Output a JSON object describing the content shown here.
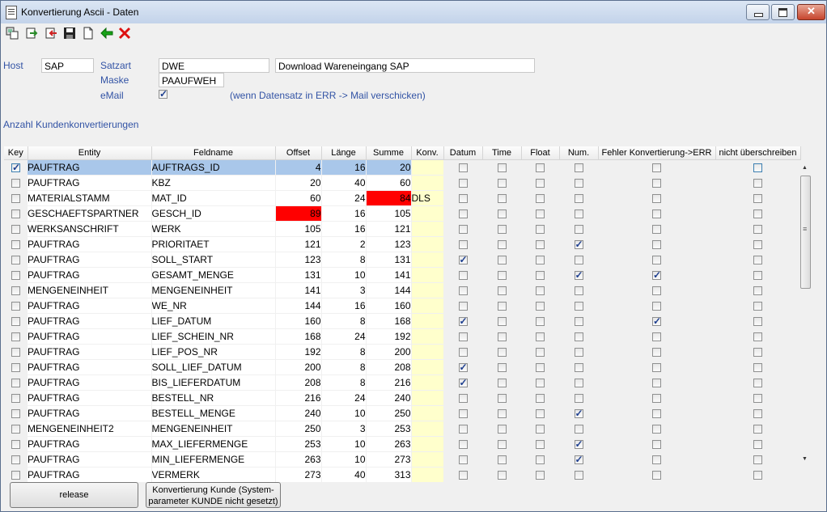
{
  "window": {
    "title": "Konvertierung Ascii - Daten"
  },
  "toolbar": {
    "icons": [
      "copy-icon",
      "export-icon",
      "import-icon",
      "save-icon",
      "new-document-icon",
      "back-arrow-icon",
      "delete-icon"
    ]
  },
  "form": {
    "host_label": "Host",
    "host_value": "SAP",
    "satzart_label": "Satzart",
    "satzart_value": "DWE",
    "satzart_desc": "Download Wareneingang SAP",
    "maske_label": "Maske",
    "maske_value": "PAAUFWEH",
    "email_label": "eMail",
    "email_checked": true,
    "email_note": "(wenn Datensatz in ERR -> Mail verschicken)",
    "anzahl_label": "Anzahl Kundenkonvertierungen"
  },
  "table": {
    "headers": [
      "Key",
      "Entity",
      "Feldname",
      "Offset",
      "Länge",
      "Summe",
      "Konv.",
      "Datum",
      "Time",
      "Float",
      "Num.",
      "Fehler Konvertierung->ERR",
      "nicht überschreiben"
    ],
    "rows": [
      {
        "key": true,
        "entity": "PAUFTRAG",
        "feld": "AUFTRAGS_ID",
        "offset": "4",
        "laenge": "16",
        "summe": "20",
        "konv": "",
        "datum": false,
        "time": false,
        "float": false,
        "num": false,
        "err": false,
        "nicht": false,
        "selected": true
      },
      {
        "key": false,
        "entity": "PAUFTRAG",
        "feld": "KBZ",
        "offset": "20",
        "laenge": "40",
        "summe": "60",
        "konv": "",
        "datum": false,
        "time": false,
        "float": false,
        "num": false,
        "err": false,
        "nicht": false
      },
      {
        "key": false,
        "entity": "MATERIALSTAMM",
        "feld": "MAT_ID",
        "offset": "60",
        "laenge": "24",
        "summe": "84",
        "konv": "DLS",
        "datum": false,
        "time": false,
        "float": false,
        "num": false,
        "err": false,
        "nicht": false,
        "summe_error": true
      },
      {
        "key": false,
        "entity": "GESCHAEFTSPARTNER",
        "feld": "GESCH_ID",
        "offset": "89",
        "laenge": "16",
        "summe": "105",
        "konv": "",
        "datum": false,
        "time": false,
        "float": false,
        "num": false,
        "err": false,
        "nicht": false,
        "offset_error": true
      },
      {
        "key": false,
        "entity": "WERKSANSCHRIFT",
        "feld": "WERK",
        "offset": "105",
        "laenge": "16",
        "summe": "121",
        "konv": "",
        "datum": false,
        "time": false,
        "float": false,
        "num": false,
        "err": false,
        "nicht": false
      },
      {
        "key": false,
        "entity": "PAUFTRAG",
        "feld": "PRIORITAET",
        "offset": "121",
        "laenge": "2",
        "summe": "123",
        "konv": "",
        "datum": false,
        "time": false,
        "float": false,
        "num": true,
        "err": false,
        "nicht": false
      },
      {
        "key": false,
        "entity": "PAUFTRAG",
        "feld": "SOLL_START",
        "offset": "123",
        "laenge": "8",
        "summe": "131",
        "konv": "",
        "datum": true,
        "time": false,
        "float": false,
        "num": false,
        "err": false,
        "nicht": false
      },
      {
        "key": false,
        "entity": "PAUFTRAG",
        "feld": "GESAMT_MENGE",
        "offset": "131",
        "laenge": "10",
        "summe": "141",
        "konv": "",
        "datum": false,
        "time": false,
        "float": false,
        "num": true,
        "err": true,
        "nicht": false
      },
      {
        "key": false,
        "entity": "MENGENEINHEIT",
        "feld": "MENGENEINHEIT",
        "offset": "141",
        "laenge": "3",
        "summe": "144",
        "konv": "",
        "datum": false,
        "time": false,
        "float": false,
        "num": false,
        "err": false,
        "nicht": false
      },
      {
        "key": false,
        "entity": "PAUFTRAG",
        "feld": "WE_NR",
        "offset": "144",
        "laenge": "16",
        "summe": "160",
        "konv": "",
        "datum": false,
        "time": false,
        "float": false,
        "num": false,
        "err": false,
        "nicht": false
      },
      {
        "key": false,
        "entity": "PAUFTRAG",
        "feld": "LIEF_DATUM",
        "offset": "160",
        "laenge": "8",
        "summe": "168",
        "konv": "",
        "datum": true,
        "time": false,
        "float": false,
        "num": false,
        "err": true,
        "nicht": false
      },
      {
        "key": false,
        "entity": "PAUFTRAG",
        "feld": "LIEF_SCHEIN_NR",
        "offset": "168",
        "laenge": "24",
        "summe": "192",
        "konv": "",
        "datum": false,
        "time": false,
        "float": false,
        "num": false,
        "err": false,
        "nicht": false
      },
      {
        "key": false,
        "entity": "PAUFTRAG",
        "feld": "LIEF_POS_NR",
        "offset": "192",
        "laenge": "8",
        "summe": "200",
        "konv": "",
        "datum": false,
        "time": false,
        "float": false,
        "num": false,
        "err": false,
        "nicht": false
      },
      {
        "key": false,
        "entity": "PAUFTRAG",
        "feld": "SOLL_LIEF_DATUM",
        "offset": "200",
        "laenge": "8",
        "summe": "208",
        "konv": "",
        "datum": true,
        "time": false,
        "float": false,
        "num": false,
        "err": false,
        "nicht": false
      },
      {
        "key": false,
        "entity": "PAUFTRAG",
        "feld": "BIS_LIEFERDATUM",
        "offset": "208",
        "laenge": "8",
        "summe": "216",
        "konv": "",
        "datum": true,
        "time": false,
        "float": false,
        "num": false,
        "err": false,
        "nicht": false
      },
      {
        "key": false,
        "entity": "PAUFTRAG",
        "feld": "BESTELL_NR",
        "offset": "216",
        "laenge": "24",
        "summe": "240",
        "konv": "",
        "datum": false,
        "time": false,
        "float": false,
        "num": false,
        "err": false,
        "nicht": false
      },
      {
        "key": false,
        "entity": "PAUFTRAG",
        "feld": "BESTELL_MENGE",
        "offset": "240",
        "laenge": "10",
        "summe": "250",
        "konv": "",
        "datum": false,
        "time": false,
        "float": false,
        "num": true,
        "err": false,
        "nicht": false
      },
      {
        "key": false,
        "entity": "MENGENEINHEIT2",
        "feld": "MENGENEINHEIT",
        "offset": "250",
        "laenge": "3",
        "summe": "253",
        "konv": "",
        "datum": false,
        "time": false,
        "float": false,
        "num": false,
        "err": false,
        "nicht": false
      },
      {
        "key": false,
        "entity": "PAUFTRAG",
        "feld": "MAX_LIEFERMENGE",
        "offset": "253",
        "laenge": "10",
        "summe": "263",
        "konv": "",
        "datum": false,
        "time": false,
        "float": false,
        "num": true,
        "err": false,
        "nicht": false
      },
      {
        "key": false,
        "entity": "PAUFTRAG",
        "feld": "MIN_LIEFERMENGE",
        "offset": "263",
        "laenge": "10",
        "summe": "273",
        "konv": "",
        "datum": false,
        "time": false,
        "float": false,
        "num": true,
        "err": false,
        "nicht": false
      },
      {
        "key": false,
        "entity": "PAUFTRAG",
        "feld": "VERMERK",
        "offset": "273",
        "laenge": "40",
        "summe": "313",
        "konv": "",
        "datum": false,
        "time": false,
        "float": false,
        "num": false,
        "err": false,
        "nicht": false
      }
    ]
  },
  "buttons": {
    "release": "release",
    "konv_kunde_line1": "Konvertierung Kunde (System-",
    "konv_kunde_line2": "parameter KUNDE nicht gesetzt)"
  },
  "colors": {
    "error": "#ff0000",
    "selection": "#a9c7ea",
    "konv_bg": "#ffffcc",
    "label": "#3253a5"
  }
}
